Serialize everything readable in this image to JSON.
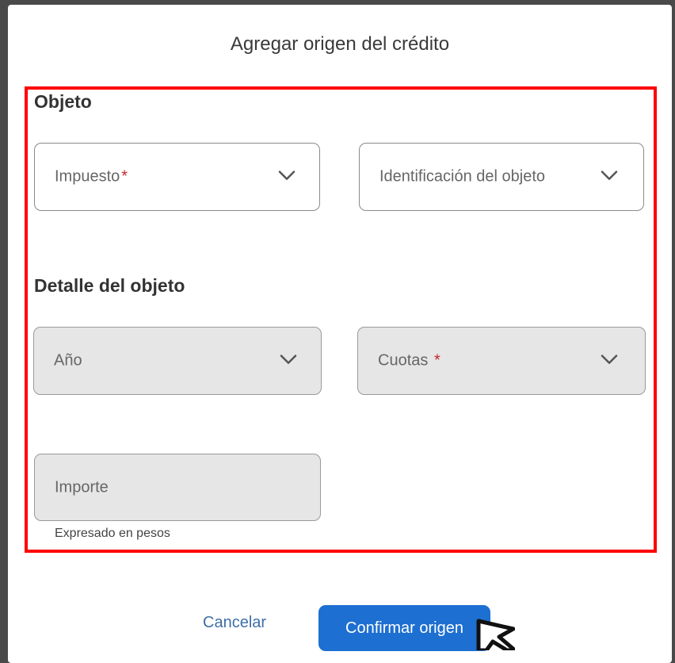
{
  "dialog": {
    "title": "Agregar origen del crédito"
  },
  "sections": {
    "objeto": {
      "title": "Objeto",
      "impuesto": {
        "label": "Impuesto",
        "required": "*"
      },
      "identificacion": {
        "label": "Identificación del objeto"
      }
    },
    "detalle": {
      "title": "Detalle del objeto",
      "anio": {
        "label": "Año"
      },
      "cuotas": {
        "label": "Cuotas",
        "required": "*"
      },
      "importe": {
        "label": "Importe",
        "helper": "Expresado en pesos"
      }
    }
  },
  "actions": {
    "cancel_label": "Cancelar",
    "confirm_label": "Confirmar origen"
  },
  "colors": {
    "highlight": "#ff0000",
    "primary": "#1d6fd1",
    "link": "#3d6fa8",
    "required": "#c62828"
  },
  "icons": {
    "dropdown": "chevron-down-icon",
    "pointer": "mouse-cursor-icon"
  }
}
